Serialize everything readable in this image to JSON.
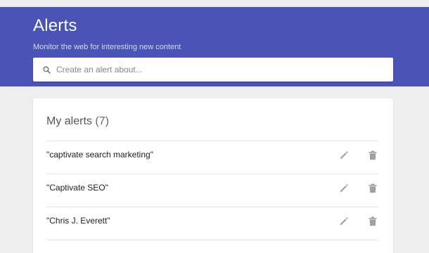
{
  "colors": {
    "header_bg": "#4a54b6",
    "page_bg": "#eeeeee",
    "icon_gray": "#9e9e9e"
  },
  "header": {
    "title": "Alerts",
    "subtitle": "Monitor the web for interesting new content"
  },
  "search": {
    "icon": "search-icon",
    "placeholder": "Create an alert about..."
  },
  "my_alerts": {
    "heading": "My alerts",
    "count": "(7)",
    "items": [
      {
        "label": "\"captivate search marketing\"",
        "edit_icon": "pencil-icon",
        "delete_icon": "trash-icon"
      },
      {
        "label": "\"Captivate SEO\"",
        "edit_icon": "pencil-icon",
        "delete_icon": "trash-icon"
      },
      {
        "label": "\"Chris J. Everett\"",
        "edit_icon": "pencil-icon",
        "delete_icon": "trash-icon"
      }
    ]
  }
}
